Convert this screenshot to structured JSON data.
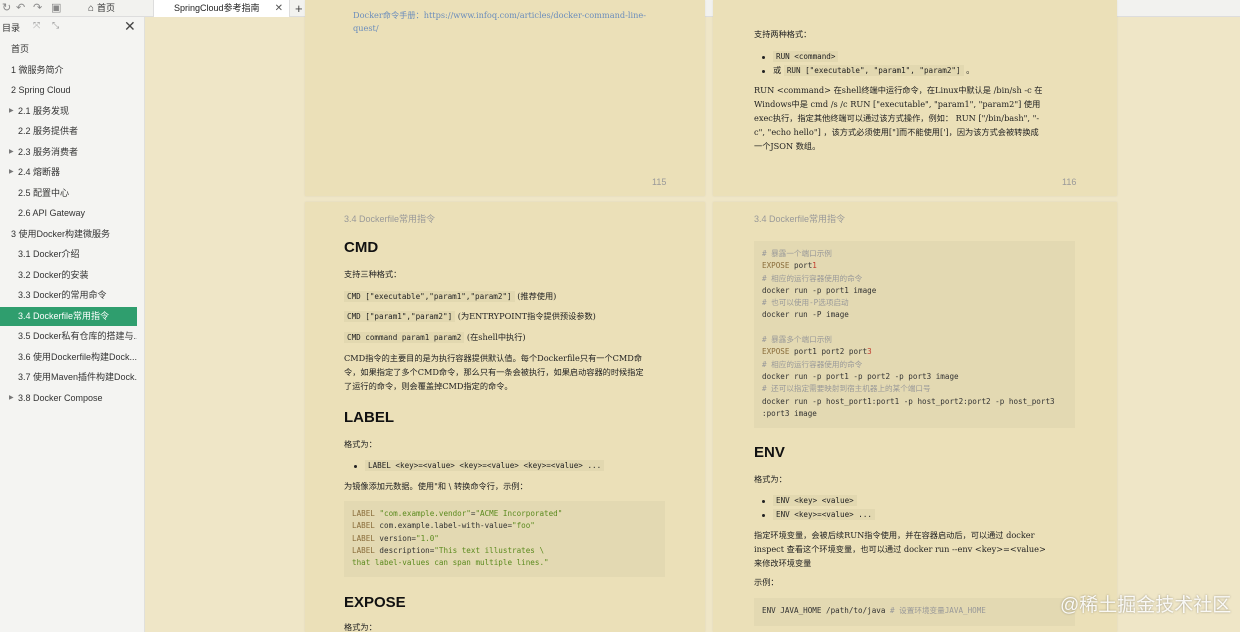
{
  "toolbar": {
    "home_label": "首页",
    "tab_label": "SpringCloud参考指南",
    "add_tab": "+"
  },
  "sidebar": {
    "title": "目录",
    "items": [
      {
        "label": "首页",
        "level": 0
      },
      {
        "label": "1 微服务简介",
        "level": 0
      },
      {
        "label": "2 Spring Cloud",
        "level": 0
      },
      {
        "label": "2.1 服务发现",
        "level": 1,
        "expandable": true
      },
      {
        "label": "2.2 服务提供者",
        "level": 1
      },
      {
        "label": "2.3 服务消费者",
        "level": 1,
        "expandable": true
      },
      {
        "label": "2.4 熔断器",
        "level": 1,
        "expandable": true
      },
      {
        "label": "2.5 配置中心",
        "level": 1
      },
      {
        "label": "2.6 API Gateway",
        "level": 1
      },
      {
        "label": "3 使用Docker构建微服务",
        "level": 0
      },
      {
        "label": "3.1 Docker介绍",
        "level": 1
      },
      {
        "label": "3.2 Docker的安装",
        "level": 1
      },
      {
        "label": "3.3 Docker的常用命令",
        "level": 1
      },
      {
        "label": "3.4 Dockerfile常用指令",
        "level": 1,
        "active": true
      },
      {
        "label": "3.5 Docker私有仓库的搭建与...",
        "level": 1
      },
      {
        "label": "3.6 使用Dockerfile构建Dock...",
        "level": 1
      },
      {
        "label": "3.7 使用Maven插件构建Dock...",
        "level": 1
      },
      {
        "label": "3.8 Docker Compose",
        "level": 1,
        "expandable": true
      }
    ]
  },
  "page115": {
    "line1": "Docker命令手册：https://www.infoq.com/articles/docker-command-line-",
    "line2": "quest/",
    "page_number": "115"
  },
  "page116": {
    "intro": "支持两种格式：",
    "b1_code": "RUN <command>",
    "b2_prefix": "或",
    "b2_code": "RUN [\"executable\", \"param1\", \"param2\"]",
    "b2_suffix": "。",
    "p1_line1": "RUN <command> 在shell终端中运行命令，在Linux中默认是 /bin/sh -c 在",
    "p1_line2": "Windows中是 cmd /s /c  RUN [\"executable\", \"param1\", \"param2\"] 使用",
    "p1_line3": "exec执行，指定其他终端可以通过该方式操作，例如： RUN [\"/bin/bash\", \"-",
    "p1_line4": "c\", \"echo hello\"] ，该方式必须使用[\"]而不能使用[']，因为该方式会被转换成",
    "p1_line5": "一个JSON 数组。",
    "page_number": "116"
  },
  "page117": {
    "running_head": "3.4 Dockerfile常用指令",
    "cmd_heading": "CMD",
    "cmd_intro": "支持三种格式：",
    "cmd1_code": "CMD [\"executable\",\"param1\",\"param2\"]",
    "cmd1_note": "(推荐使用)",
    "cmd2_code": "CMD [\"param1\",\"param2\"]",
    "cmd2_note": "(为ENTRYPOINT指令提供预设参数)",
    "cmd3_code": "CMD command param1 param2",
    "cmd3_note": "(在shell中执行)",
    "cmd_p_line1": "CMD指令的主要目的是为执行容器提供默认值。每个Dockerfile只有一个CMD命",
    "cmd_p_line2": "令，如果指定了多个CMD命令，那么只有一条会被执行，如果启动容器的时候指定",
    "cmd_p_line3": "了运行的命令，则会覆盖掉CMD指定的命令。",
    "label_heading": "LABEL",
    "label_intro": "格式为：",
    "label_bullet": "LABEL <key>=<value> <key>=<value> <key>=<value> ...",
    "label_desc": "为镜像添加元数据。使用\"和 \\ 转换命令行，示例：",
    "label_code": [
      "LABEL \"com.example.vendor\"=\"ACME Incorporated\"",
      "LABEL com.example.label-with-value=\"foo\"",
      "LABEL version=\"1.0\"",
      "LABEL description=\"This text illustrates \\",
      "that label-values can span multiple lines.\""
    ],
    "expose_heading": "EXPOSE",
    "expose_intro": "格式为："
  },
  "page118": {
    "running_head": "3.4 Dockerfile常用指令",
    "code": [
      "# 暴露一个端口示例",
      "EXPOSE port1",
      "# 相应的运行容器使用的命令",
      "docker run -p port1 image",
      "# 也可以使用-P选项启动",
      "docker run -P image",
      "",
      "# 暴露多个端口示例",
      "EXPOSE port1 port2 port3",
      "# 相应的运行容器使用的命令",
      "docker run -p port1 -p port2 -p port3 image",
      "# 还可以指定需要映射到宿主机器上的某个端口号",
      "docker run -p host_port1:port1 -p host_port2:port2 -p host_port3",
      ":port3 image"
    ],
    "env_heading": "ENV",
    "env_intro": "格式为：",
    "env_b1": "ENV <key> <value>",
    "env_b2": "ENV <key>=<value> ...",
    "env_p_line1": "指定环境变量，会被后续RUN指令使用，并在容器启动后，可以通过 docker",
    "env_p_line2": "inspect 查看这个环境变量，也可以通过 docker run --env <key>=<value>",
    "env_p_line3": "来修改环境变量",
    "env_example_label": "示例：",
    "env_example_code": "ENV JAVA_HOME /path/to/java",
    "env_example_comment": "# 设置环境变量JAVA_HOME"
  },
  "watermark": "@稀土掘金技术社区"
}
